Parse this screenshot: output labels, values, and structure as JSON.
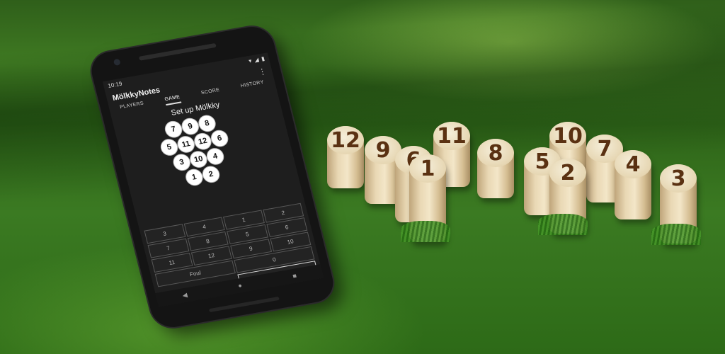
{
  "status_bar": {
    "time": "10:19",
    "icons": [
      "gear-icon",
      "shield-icon",
      "lock-icon"
    ],
    "right_icons": [
      "wifi-icon",
      "signal-icon",
      "battery-icon"
    ]
  },
  "app": {
    "title": "MölkkyNotes",
    "menu_glyph": "⋮"
  },
  "tabs": [
    {
      "label": "PLAYERS"
    },
    {
      "label": "GAME",
      "active": true
    },
    {
      "label": "SCORE"
    },
    {
      "label": "HISTORY"
    }
  ],
  "game": {
    "panel_title": "Set up Mölkky",
    "pins": [
      "7",
      "9",
      "8",
      "5",
      "11",
      "12",
      "6",
      "3",
      "10",
      "4",
      "1",
      "2"
    ]
  },
  "keypad": {
    "keys": [
      "1",
      "2",
      "3",
      "4",
      "5",
      "6",
      "7",
      "8",
      "9",
      "10",
      "11",
      "12"
    ],
    "zero": "0",
    "foul": "Foul",
    "next": "▶"
  },
  "nav": {
    "back": "◀",
    "home": "●",
    "recents": "■"
  },
  "skittles": [
    "12",
    "9",
    "6",
    "1",
    "11",
    "8",
    "5",
    "2",
    "10",
    "7",
    "4",
    "3"
  ],
  "colors": {
    "grass": "#3b7a22",
    "wood": "#e9d8b4",
    "number_brown": "#5a3112",
    "screen_bg": "#1e1e1e"
  }
}
